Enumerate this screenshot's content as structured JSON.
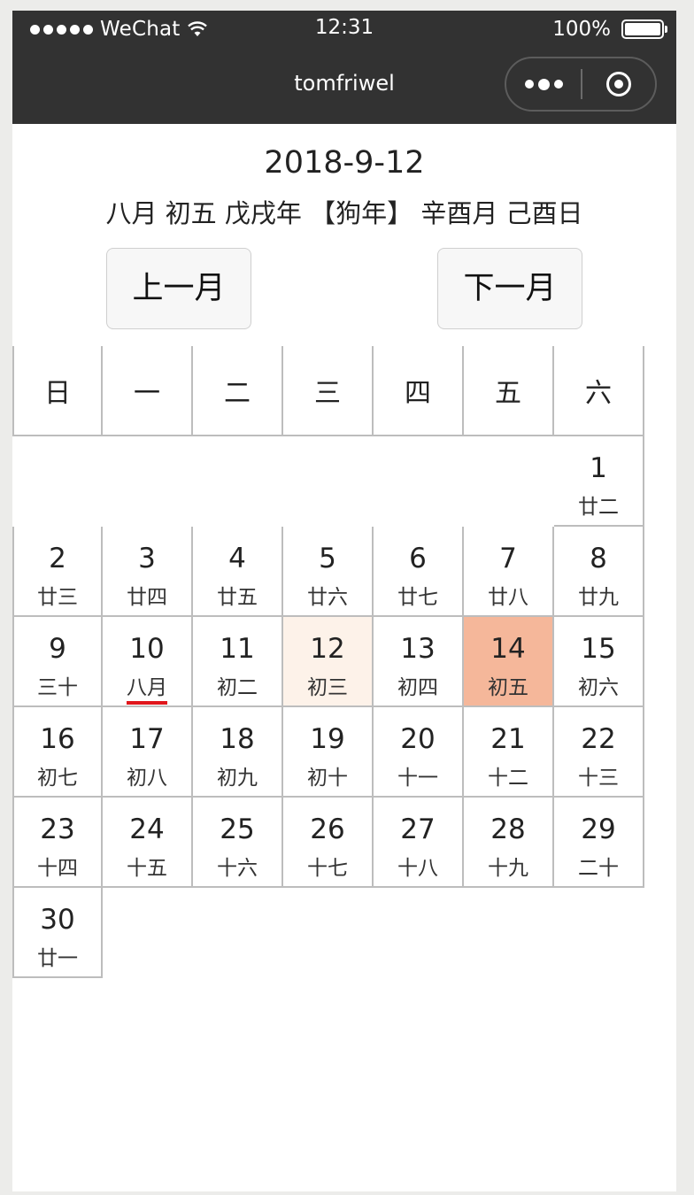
{
  "status_bar": {
    "carrier": "WeChat",
    "time": "12:31",
    "battery": "100%"
  },
  "nav": {
    "title": "tomfriwel"
  },
  "header": {
    "date": "2018-9-12",
    "lunar_info": "八月 初五 戊戌年 【狗年】 辛酉月 己酉日"
  },
  "buttons": {
    "prev": "上一月",
    "next": "下一月"
  },
  "weekdays": [
    "日",
    "一",
    "二",
    "三",
    "四",
    "五",
    "六"
  ],
  "calendar": {
    "leading_blanks": 6,
    "today_day": "12",
    "selected_day": "14",
    "month_start_day": "10",
    "days": [
      {
        "day": "1",
        "lunar": "廿二"
      },
      {
        "day": "2",
        "lunar": "廿三"
      },
      {
        "day": "3",
        "lunar": "廿四"
      },
      {
        "day": "4",
        "lunar": "廿五"
      },
      {
        "day": "5",
        "lunar": "廿六"
      },
      {
        "day": "6",
        "lunar": "廿七"
      },
      {
        "day": "7",
        "lunar": "廿八"
      },
      {
        "day": "8",
        "lunar": "廿九"
      },
      {
        "day": "9",
        "lunar": "三十"
      },
      {
        "day": "10",
        "lunar": "八月"
      },
      {
        "day": "11",
        "lunar": "初二"
      },
      {
        "day": "12",
        "lunar": "初三"
      },
      {
        "day": "13",
        "lunar": "初四"
      },
      {
        "day": "14",
        "lunar": "初五"
      },
      {
        "day": "15",
        "lunar": "初六"
      },
      {
        "day": "16",
        "lunar": "初七"
      },
      {
        "day": "17",
        "lunar": "初八"
      },
      {
        "day": "18",
        "lunar": "初九"
      },
      {
        "day": "19",
        "lunar": "初十"
      },
      {
        "day": "20",
        "lunar": "十一"
      },
      {
        "day": "21",
        "lunar": "十二"
      },
      {
        "day": "22",
        "lunar": "十三"
      },
      {
        "day": "23",
        "lunar": "十四"
      },
      {
        "day": "24",
        "lunar": "十五"
      },
      {
        "day": "25",
        "lunar": "十六"
      },
      {
        "day": "26",
        "lunar": "十七"
      },
      {
        "day": "27",
        "lunar": "十八"
      },
      {
        "day": "28",
        "lunar": "十九"
      },
      {
        "day": "29",
        "lunar": "二十"
      },
      {
        "day": "30",
        "lunar": "廿一"
      }
    ]
  },
  "colors": {
    "nav_background": "#323232",
    "today_highlight": "#fdf2e9",
    "selected_highlight": "#f5b79a",
    "month_start_underline": "#e0161b"
  },
  "icons": {
    "signal": "signal-dots-icon",
    "wifi": "wifi-icon",
    "battery": "battery-icon",
    "more": "more-dots-icon",
    "close": "target-circle-icon"
  }
}
